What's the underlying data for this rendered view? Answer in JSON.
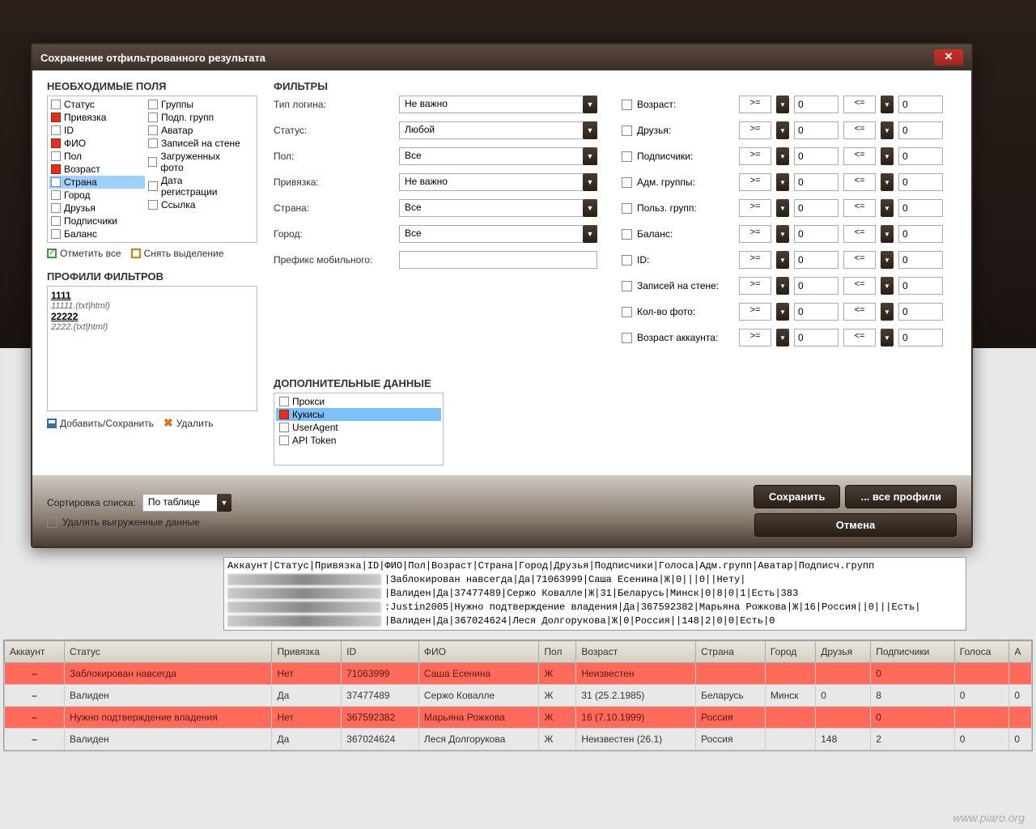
{
  "dialog": {
    "title": "Сохранение отфильтрованного результата",
    "close": "✕"
  },
  "fields": {
    "title": "НЕОБХОДИМЫЕ ПОЛЯ",
    "col1": [
      {
        "label": "Статус",
        "checked": false
      },
      {
        "label": "Привязка",
        "checked": true
      },
      {
        "label": "ID",
        "checked": false
      },
      {
        "label": "ФИО",
        "checked": true
      },
      {
        "label": "Пол",
        "checked": false
      },
      {
        "label": "Возраст",
        "checked": true
      },
      {
        "label": "Страна",
        "checked": false,
        "selected": true
      },
      {
        "label": "Город",
        "checked": false
      },
      {
        "label": "Друзья",
        "checked": false
      },
      {
        "label": "Подписчики",
        "checked": false
      },
      {
        "label": "Баланс",
        "checked": false
      }
    ],
    "col2": [
      {
        "label": "Группы",
        "checked": false
      },
      {
        "label": "Подп. групп",
        "checked": false
      },
      {
        "label": "Аватар",
        "checked": false
      },
      {
        "label": "Записей на стене",
        "checked": false
      },
      {
        "label": "Загруженных фото",
        "checked": false
      },
      {
        "label": "Дата регистрации",
        "checked": false
      },
      {
        "label": "Ссылка",
        "checked": false
      }
    ],
    "select_all": "Отметить все",
    "deselect": "Снять выделение"
  },
  "profiles": {
    "title": "ПРОФИЛИ ФИЛЬТРОВ",
    "items": [
      {
        "name": "1111",
        "path": "11111.(txt|html)"
      },
      {
        "name": "22222",
        "path": "2222.(txt|html)"
      }
    ],
    "add_save": "Добавить/Сохранить",
    "delete": "Удалить"
  },
  "filters": {
    "title": "ФИЛЬТРЫ",
    "rows": [
      {
        "label": "Тип логина:",
        "value": "Не важно"
      },
      {
        "label": "Статус:",
        "value": "Любой"
      },
      {
        "label": "Пол:",
        "value": "Все"
      },
      {
        "label": "Привязка:",
        "value": "Не важно"
      },
      {
        "label": "Страна:",
        "value": "Все"
      },
      {
        "label": "Город:",
        "value": "Все"
      }
    ],
    "prefix_label": "Префикс мобильного:",
    "ranges": [
      {
        "label": "Возраст:",
        "op1": ">=",
        "v1": "0",
        "op2": "<=",
        "v2": "0"
      },
      {
        "label": "Друзья:",
        "op1": ">=",
        "v1": "0",
        "op2": "<=",
        "v2": "0"
      },
      {
        "label": "Подписчики:",
        "op1": ">=",
        "v1": "0",
        "op2": "<=",
        "v2": "0"
      },
      {
        "label": "Адм. группы:",
        "op1": ">=",
        "v1": "0",
        "op2": "<=",
        "v2": "0"
      },
      {
        "label": "Польз. групп:",
        "op1": ">=",
        "v1": "0",
        "op2": "<=",
        "v2": "0"
      },
      {
        "label": "Баланс:",
        "op1": ">=",
        "v1": "0",
        "op2": "<=",
        "v2": "0"
      },
      {
        "label": "ID:",
        "op1": ">=",
        "v1": "0",
        "op2": "<=",
        "v2": "0"
      },
      {
        "label": "Записей на стене:",
        "op1": ">=",
        "v1": "0",
        "op2": "<=",
        "v2": "0"
      },
      {
        "label": "Кол-во фото:",
        "op1": ">=",
        "v1": "0",
        "op2": "<=",
        "v2": "0"
      },
      {
        "label": "Возраст аккаунта:",
        "op1": ">=",
        "v1": "0",
        "op2": "<=",
        "v2": "0"
      }
    ]
  },
  "extra": {
    "title": "ДОПОЛНИТЕЛЬНЫЕ ДАННЫЕ",
    "items": [
      {
        "label": "Прокси",
        "checked": false
      },
      {
        "label": "Кукисы",
        "checked": true,
        "selected": true
      },
      {
        "label": "UserAgent",
        "checked": false
      },
      {
        "label": "API Token",
        "checked": false
      }
    ]
  },
  "bottom": {
    "sort_label": "Сортировка списка:",
    "sort_value": "По таблице",
    "delete_uploaded": "Удалять выгруженные данные",
    "save": "Сохранить",
    "all_profiles": "... все профили",
    "cancel": "Отмена"
  },
  "log": {
    "header": "Аккаунт|Статус|Привязка|ID|ФИО|Пол|Возраст|Страна|Город|Друзья|Подписчики|Голоса|Адм.групп|Аватар|Подписч.групп",
    "l1": "|Заблокирован навсегда|Да|71063999|Саша Есенина|Ж|0|||0||Нету|",
    "l2": "|Валиден|Да|37477489|Сержо Ковалле|Ж|31|Беларусь|Минск|0|8|0|1|Есть|383",
    "l3": ":Justin2005|Нужно подтверждение владения|Да|367592382|Марьяна Рожкова|Ж|16|Россия||0|||Есть|",
    "l4": "|Валиден|Да|367024624|Леся Долгорукова|Ж|0|Россия||148|2|0|0|Есть|0"
  },
  "table": {
    "headers": [
      "Аккаунт",
      "Статус",
      "Привязка",
      "ID",
      "ФИО",
      "Пол",
      "Возраст",
      "Страна",
      "Город",
      "Друзья",
      "Подписчики",
      "Голоса",
      "А"
    ],
    "rows": [
      {
        "red": true,
        "cells": [
          "–",
          "Заблокирован навсегда",
          "Нет",
          "71063999",
          "Саша Есенина",
          "Ж",
          "Неизвестен",
          "",
          "",
          "",
          "0",
          "",
          ""
        ]
      },
      {
        "red": false,
        "cells": [
          "–",
          "Валиден",
          "Да",
          "37477489",
          "Сержо Ковалле",
          "Ж",
          "31 (25.2.1985)",
          "Беларусь",
          "Минск",
          "0",
          "8",
          "0",
          "0"
        ]
      },
      {
        "red": true,
        "cells": [
          "–",
          "Нужно подтверждение владения",
          "Нет",
          "367592382",
          "Марьяна Рожкова",
          "Ж",
          "16 (7.10.1999)",
          "Россия",
          "",
          "",
          "0",
          "",
          ""
        ]
      },
      {
        "red": false,
        "cells": [
          "–",
          "Валиден",
          "Да",
          "367024624",
          "Леся Долгорукова",
          "Ж",
          "Неизвестен (26.1)",
          "Россия",
          "",
          "148",
          "2",
          "0",
          "0"
        ]
      }
    ]
  },
  "watermark": "www.piaro.org"
}
